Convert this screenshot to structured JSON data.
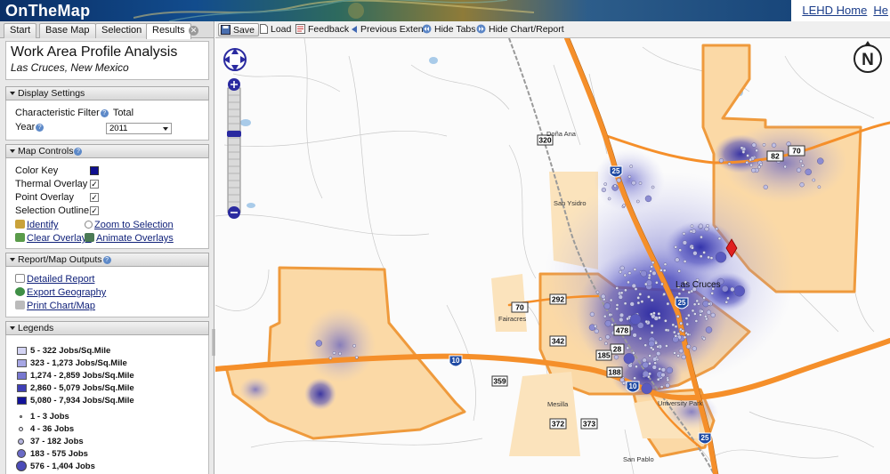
{
  "header": {
    "logo": "OnTheMap",
    "links": [
      "LEHD Home",
      "He"
    ]
  },
  "tabs": [
    "Start",
    "Base Map",
    "Selection",
    "Results"
  ],
  "active_tab": "Results",
  "analysis": {
    "title": "Work Area Profile Analysis",
    "location": "Las Cruces, New Mexico"
  },
  "display_settings": {
    "heading": "Display Settings",
    "characteristic_label": "Characteristic Filter",
    "characteristic_value": "Total",
    "year_label": "Year",
    "year_value": "2011"
  },
  "map_controls": {
    "heading": "Map Controls",
    "items": [
      {
        "label": "Color Key",
        "type": "swatch"
      },
      {
        "label": "Thermal Overlay",
        "type": "check",
        "checked": true
      },
      {
        "label": "Point Overlay",
        "type": "check",
        "checked": true
      },
      {
        "label": "Selection Outline",
        "type": "check",
        "checked": true
      }
    ],
    "identify": "Identify",
    "zoom_to_selection": "Zoom to Selection",
    "clear_overlays": "Clear Overlays",
    "animate_overlays": "Animate Overlays"
  },
  "outputs": {
    "heading": "Report/Map Outputs",
    "links": [
      "Detailed Report",
      "Export Geography",
      "Print Chart/Map"
    ]
  },
  "legends": {
    "heading": "Legends",
    "density": [
      {
        "label": "5 - 322  Jobs/Sq.Mile",
        "color": "#d4d4f4"
      },
      {
        "label": "323 - 1,273  Jobs/Sq.Mile",
        "color": "#a6a6e4"
      },
      {
        "label": "1,274 - 2,859  Jobs/Sq.Mile",
        "color": "#7777d0"
      },
      {
        "label": "2,860 - 5,079  Jobs/Sq.Mile",
        "color": "#3f3fb6"
      },
      {
        "label": "5,080 - 7,934  Jobs/Sq.Mile",
        "color": "#12129a"
      }
    ],
    "points": [
      {
        "label": "1 - 3 Jobs"
      },
      {
        "label": "4 - 36 Jobs"
      },
      {
        "label": "37 - 182 Jobs"
      },
      {
        "label": "183 - 575 Jobs"
      },
      {
        "label": "576 - 1,404 Jobs"
      }
    ]
  },
  "toolbar": {
    "save": "Save",
    "load": "Load",
    "feedback": "Feedback",
    "previous_extent": "Previous Extent",
    "hide_tabs": "Hide Tabs",
    "hide_chart": "Hide Chart/Report"
  },
  "map": {
    "north": "N",
    "places": [
      "Doña Ana",
      "San Ysidro",
      "Las Cruces",
      "Fairacres",
      "Mesilla",
      "University Park",
      "San Pablo"
    ],
    "shields": [
      "320",
      "70",
      "82",
      "70",
      "292",
      "342",
      "478",
      "28",
      "185",
      "188",
      "359",
      "372",
      "373"
    ],
    "interstates": [
      "25",
      "25",
      "10",
      "10",
      "25"
    ]
  },
  "colors": {
    "selection_fill": "#fbd9a6",
    "selection_outline": "#ef9a3c",
    "thermal": "#3030b0",
    "highway": "#f58f2a"
  }
}
